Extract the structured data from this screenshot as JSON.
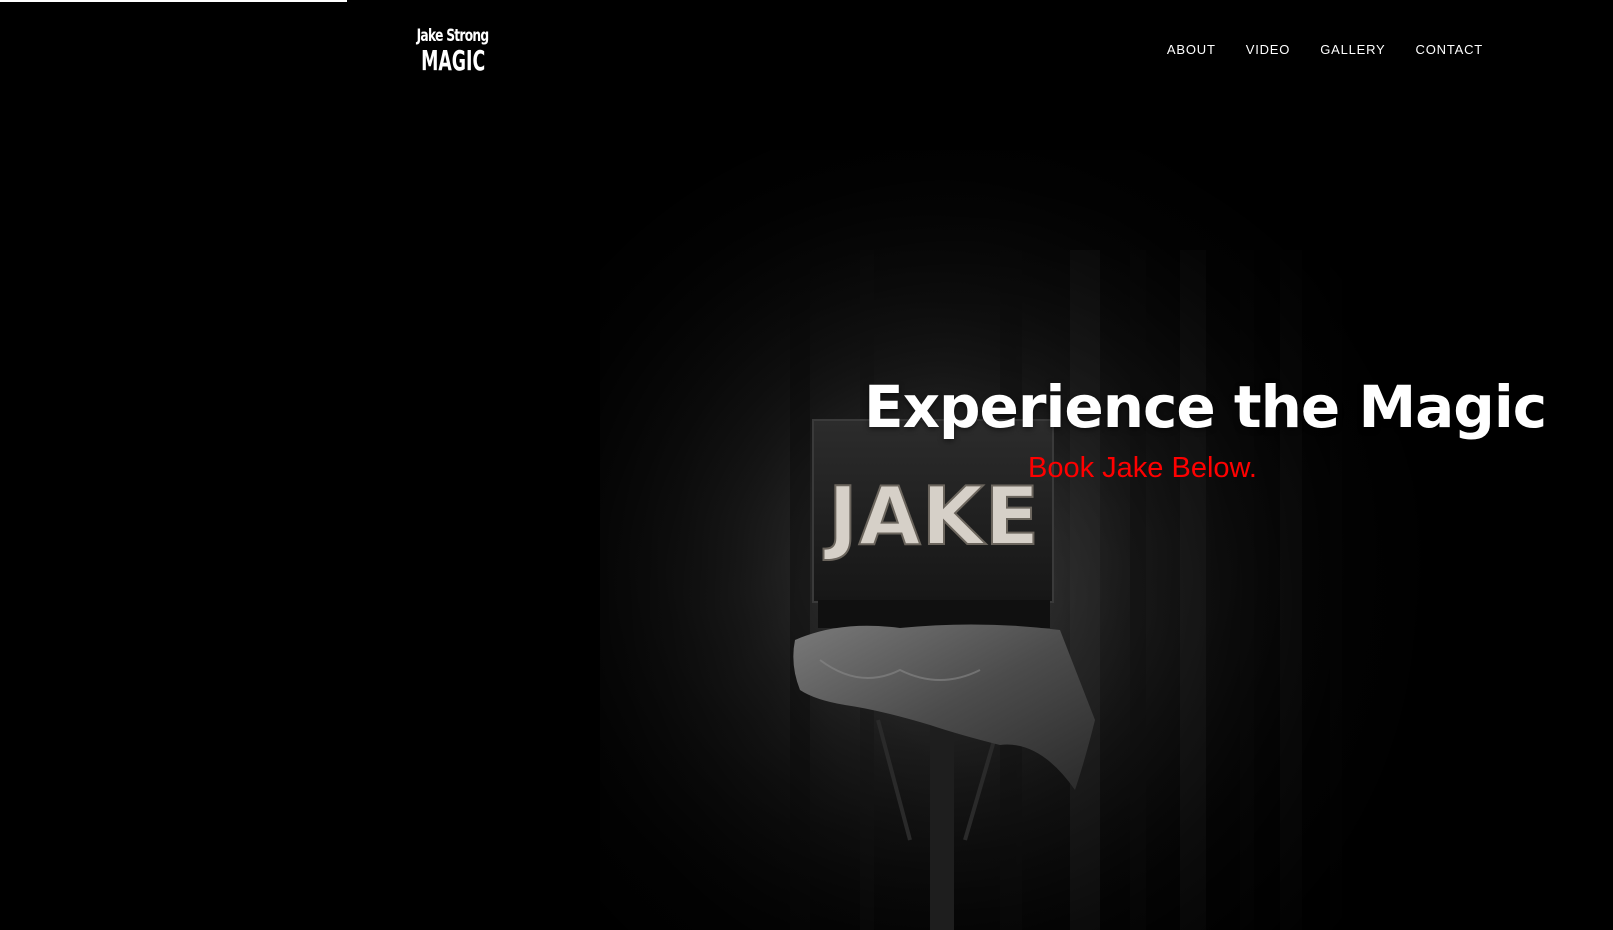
{
  "logo": {
    "line1": "Jake Strong",
    "line2": "MAGIC"
  },
  "nav": {
    "items": [
      {
        "label": "ABOUT"
      },
      {
        "label": "VIDEO"
      },
      {
        "label": "GALLERY"
      },
      {
        "label": "CONTACT"
      }
    ]
  },
  "hero": {
    "headline": "Experience the Magic",
    "subheadline": "Book Jake Below.",
    "sign_text": "JAKE"
  },
  "colors": {
    "background": "#000000",
    "text": "#ffffff",
    "accent": "#ff0000"
  }
}
